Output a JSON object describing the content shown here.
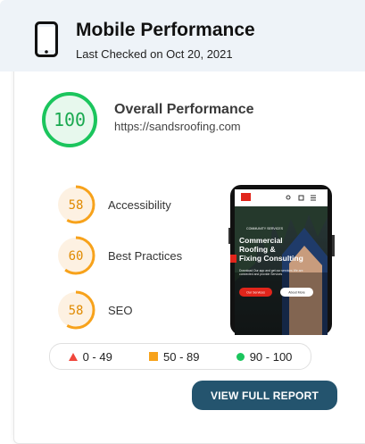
{
  "header": {
    "title": "Mobile Performance",
    "subtitle": "Last Checked on Oct 20, 2021"
  },
  "overall": {
    "score": "100",
    "label": "Overall Performance",
    "url": "https://sandsroofing.com",
    "color": "#1bc55d"
  },
  "metrics": [
    {
      "score": "58",
      "label": "Accessibility",
      "value": 0.58,
      "color": "#f7a21b"
    },
    {
      "score": "60",
      "label": "Best Practices",
      "value": 0.6,
      "color": "#f7a21b"
    },
    {
      "score": "58",
      "label": "SEO",
      "value": 0.58,
      "color": "#f7a21b"
    }
  ],
  "preview": {
    "eyebrow": "COMMUNITY SERVICES",
    "headline_line1": "Commercial",
    "headline_line2": "Roofing &",
    "headline_line3": "Fixing Consulting",
    "body": "Download Our app and get our services We are connected and provide Services",
    "primary_button": "Our Services",
    "secondary_button": "About More"
  },
  "legend": {
    "bad": "0 - 49",
    "average": "50 - 89",
    "good": "90 - 100",
    "bad_color": "#f0473c",
    "average_color": "#f7a21b",
    "good_color": "#1bc55d"
  },
  "actions": {
    "report_button": "VIEW FULL REPORT"
  }
}
